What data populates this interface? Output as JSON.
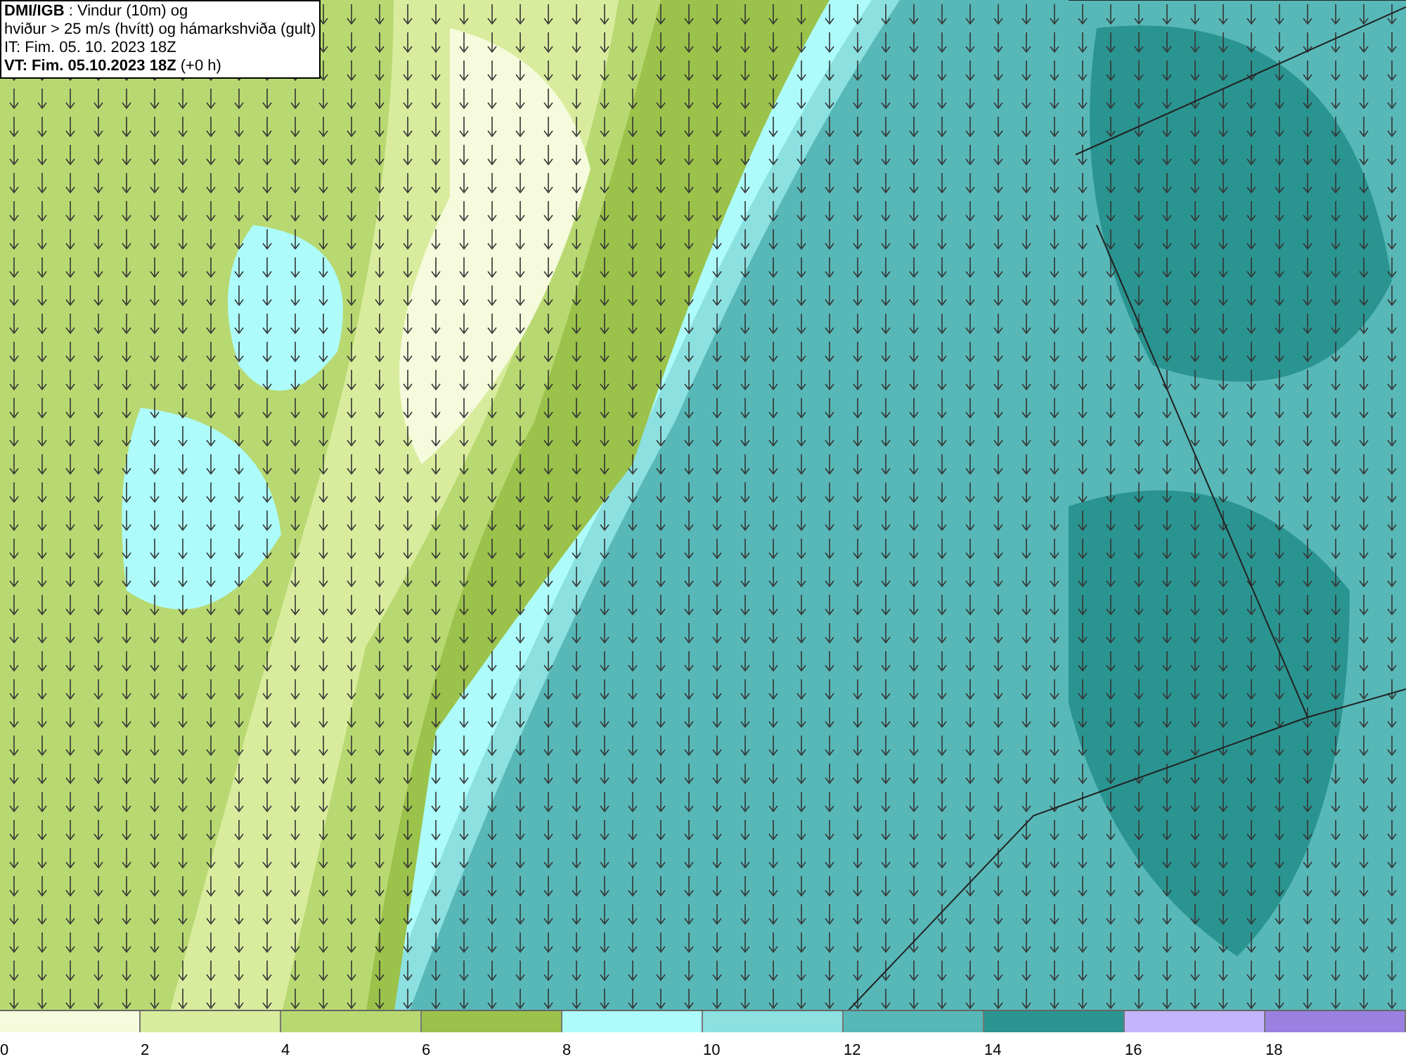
{
  "title_box": {
    "lines": [
      "**DMI/IGB** : Vindur (10m) og",
      "hviður > 25 m/s (hvítt) og hámarkshviða (gult)",
      "IT: Fim. 05. 10. 2023 18Z",
      "**VT: Fim. 05.10.2023 18Z** (+0 h)"
    ]
  },
  "legend": [
    {
      "label": "0",
      "color": "#f5fbdc"
    },
    {
      "label": "2",
      "color": "#d9ec9e"
    },
    {
      "label": "4",
      "color": "#b8d971"
    },
    {
      "label": "6",
      "color": "#9bc24a"
    },
    {
      "label": "8",
      "color": "#adfbfb"
    },
    {
      "label": "10",
      "color": "#8ce0e0"
    },
    {
      "label": "12",
      "color": "#58b8b8"
    },
    {
      "label": "14",
      "color": "#2a9490"
    },
    {
      "label": "16",
      "color": "#c4b4fc"
    },
    {
      "label": "18",
      "color": "#9a80e0"
    }
  ]
}
